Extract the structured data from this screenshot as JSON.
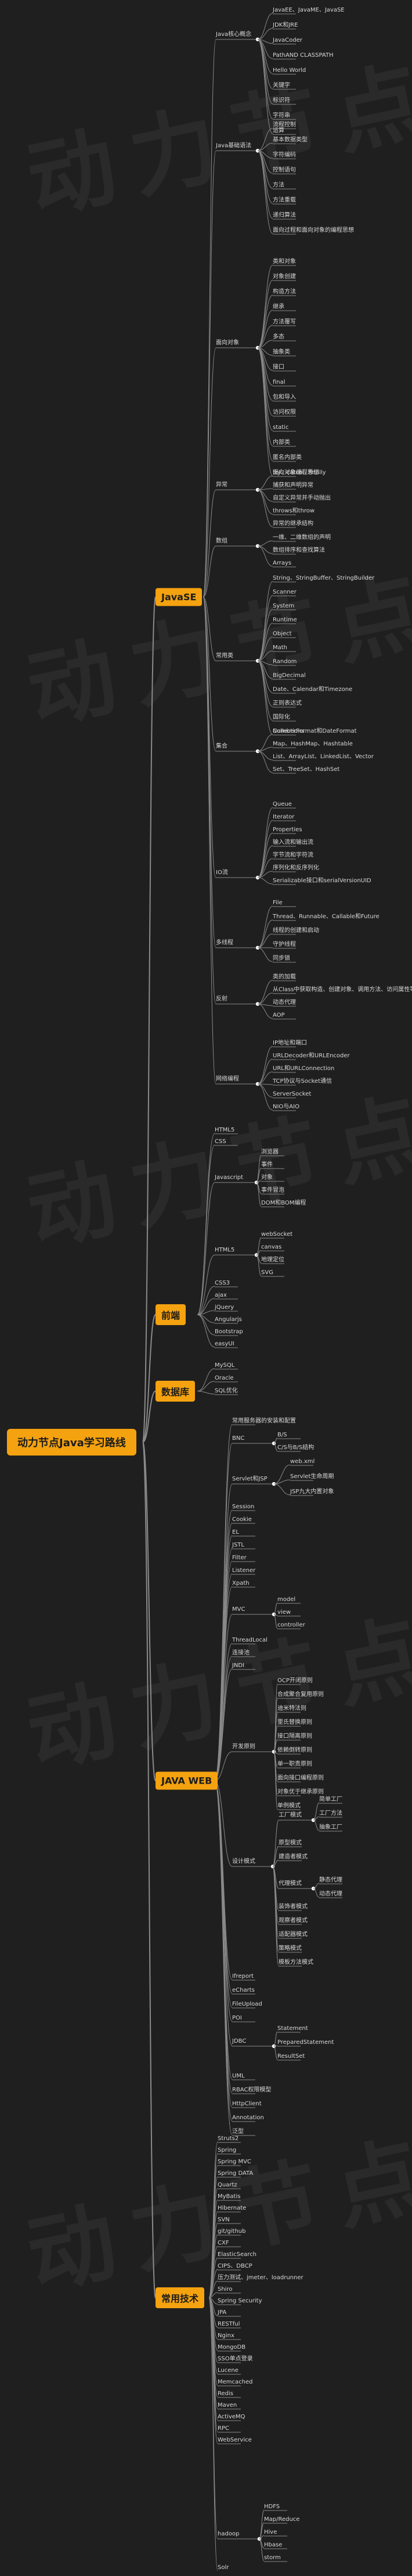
{
  "watermark": "动力节点",
  "root": "动力节点Java学习路线",
  "branches": {
    "javase": {
      "label": "JavaSE",
      "groups": {
        "basic": {
          "label": "Java核心概念",
          "items": [
            "JavaEE、JavaME、JavaSE",
            "JDK和JRE",
            "JavaCoder",
            "PathAND CLASSPATH",
            "Hello World",
            "关键字",
            "标识符",
            "字符串",
            "运算"
          ]
        },
        "syntax": {
          "label": "Java基础语法",
          "items": [
            "流程控制",
            "基本数据类型",
            "字符编码",
            "控制语句",
            "方法",
            "方法重载",
            "递归算法",
            "面向过程和面向对象的编程思想"
          ]
        },
        "oop": {
          "label": "面向对象",
          "items": [
            "类和对象",
            "对象创建",
            "构造方法",
            "继承",
            "方法覆写",
            "多态",
            "抽象类",
            "接口",
            "final",
            "包和导入",
            "访问权限",
            "static",
            "内部类",
            "匿名内部类",
            "面向对象编程思想"
          ]
        },
        "exception": {
          "label": "异常",
          "items": [
            "try、catch、finally",
            "捕获和声明异常",
            "自定义异常并手动抛出",
            "throws和throw",
            "异常的继承结构"
          ]
        },
        "array": {
          "label": "数组",
          "items": [
            "一维、二维数组的声明",
            "数组排序和查找算法",
            "Arrays"
          ]
        },
        "common": {
          "label": "常用类",
          "items": [
            "String、StringBuffer、StringBuilder",
            "Scanner",
            "System",
            "Runtime",
            "Object",
            "Math",
            "Random",
            "BigDecimal",
            "Date、Calendar和Timezone",
            "正则表达式",
            "国际化",
            "NumberFormat和DateFormat"
          ]
        },
        "collection": {
          "label": "集合",
          "items": [
            "Collections",
            "Map、HashMap、Hashtable",
            "List、ArrayList、LinkedList、Vector",
            "Set、TreeSet、HashSet"
          ]
        },
        "io": {
          "label": "IO流",
          "items": [
            "Queue",
            "Iterator",
            "Properties",
            "输入流和输出流",
            "字节流和字符流",
            "序列化和反序列化",
            "Serializable接口和serialVersionUID"
          ]
        },
        "thread": {
          "label": "多线程",
          "items": [
            "File",
            "Thread、Runnable、Callable和Future",
            "线程的创建和启动",
            "守护线程",
            "同步锁"
          ]
        },
        "reflect": {
          "label": "反射",
          "items": [
            "类的加载",
            "从Class中获取构造、创建对象、调用方法、访问属性等",
            "动态代理",
            "AOP"
          ]
        },
        "net": {
          "label": "网络编程",
          "items": [
            "IP地址和端口",
            "URLDecoder和URLEncoder",
            "URL和URLConnection",
            "TCP协议与Socket通信",
            "ServerSocket",
            "NIO与AIO"
          ]
        }
      }
    },
    "frontend": {
      "label": "前端",
      "items": [
        "HTML5",
        "CSS"
      ],
      "js": {
        "label": "Javascript",
        "items": [
          "浏览器",
          "事件",
          "对象",
          "事件冒泡",
          "DOM和BOM编程"
        ]
      },
      "html5": {
        "label": "HTML5",
        "items": [
          "webSocket",
          "canvas",
          "地理定位",
          "SVG"
        ]
      },
      "more": [
        "CSS3",
        "ajax",
        "jQuery",
        "Angularjs",
        "Bootstrap",
        "easyUI"
      ]
    },
    "db": {
      "label": "数据库",
      "items": [
        "MySQL",
        "Oracle",
        "SQL优化"
      ]
    },
    "javaweb": {
      "label": "JAVA WEB",
      "items_top": [
        "常用服务器的安装和配置"
      ],
      "bnc": {
        "label": "BNC",
        "items": [
          "B/S",
          "C/S与B/S结构"
        ]
      },
      "servlet": {
        "label": "Servlet和JSP",
        "items": [
          "web.xml",
          "Servlet生命周期",
          "JSP九大内置对象"
        ]
      },
      "mid": [
        "Session",
        "Cookie",
        "EL",
        "JSTL",
        "Filter",
        "Listener",
        "Xpath"
      ],
      "mvc": {
        "label": "MVC",
        "items": [
          "model",
          "view",
          "controller"
        ]
      },
      "mid2": [
        "ThreadLocal",
        "连接池",
        "JNDI"
      ],
      "design": {
        "label": "开发原则",
        "items": [
          "OCP开闭原则",
          "合成聚合复用原则",
          "迪米特法则",
          "里氏替换原则",
          "接口隔离原则",
          "依赖倒转原则",
          "单一职责原则",
          "面向接口编程原则",
          "对象优于继承原则",
          "单例模式"
        ]
      },
      "factory": {
        "label": "工厂模式",
        "items": [
          "简单工厂",
          "工厂方法",
          "抽象工厂"
        ]
      },
      "pattern": {
        "label": "设计模式",
        "items": [
          "原型模式",
          "建造者模式"
        ]
      },
      "proxy": {
        "label": "代理模式",
        "items": [
          "静态代理",
          "动态代理"
        ]
      },
      "pattern2": [
        "装饰者模式",
        "观察者模式",
        "适配器模式",
        "策略模式",
        "模板方法模式"
      ],
      "mid3": [
        "Ifreport",
        "eCharts",
        "FileUpload",
        "POI"
      ],
      "jdbc": {
        "label": "JDBC",
        "items": [
          "Statement",
          "PreparedStatement",
          "ResultSet"
        ]
      },
      "tail": [
        "UML",
        "RBAC权限模型",
        "HttpClient",
        "Annotation",
        "泛型"
      ]
    },
    "tech": {
      "label": "常用技术",
      "items": [
        "Struts2",
        "Spring",
        "Spring MVC",
        "Spring DATA",
        "Quartz",
        "MyBatis",
        "Hibernate",
        "SVN",
        "git/github",
        "CXF",
        "ElasticSearch",
        "CIPS、DBCP",
        "压力测试、jmeter、loadrunner",
        "Shiro",
        "Spring Security",
        "JPA",
        "RESTful",
        "Nginx",
        "MongoDB",
        "SSO单点登录",
        "Lucene",
        "Memcached",
        "Redis",
        "Maven",
        "ActiveMQ",
        "RPC",
        "WebService"
      ],
      "hadoop": {
        "label": "hadoop",
        "items": [
          "HDFS",
          "Map/Reduce",
          "Hive",
          "Hbase",
          "storm"
        ]
      },
      "solr": "Solr"
    }
  }
}
